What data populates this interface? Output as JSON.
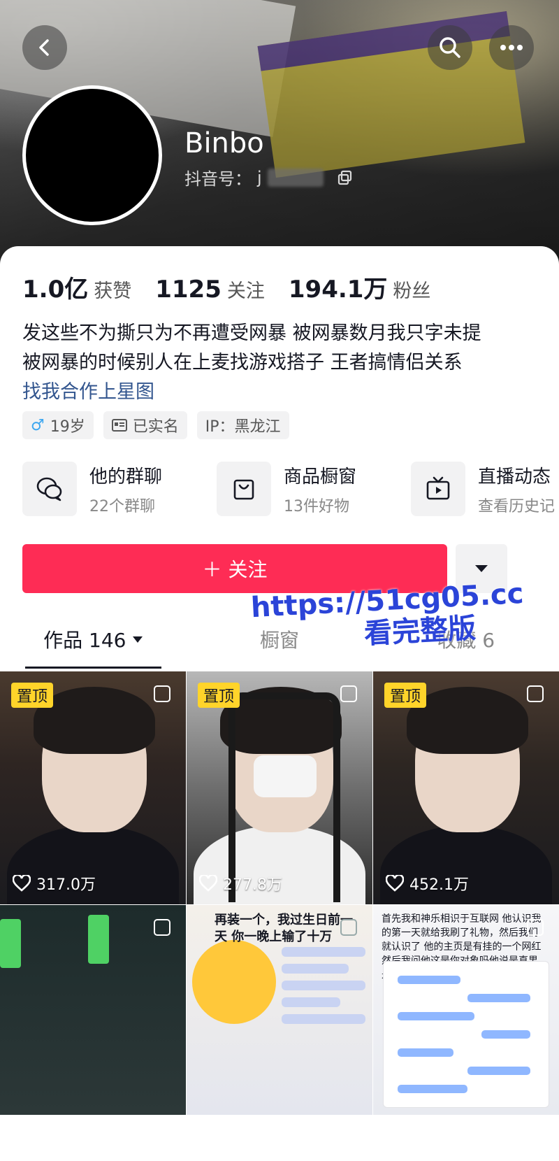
{
  "header": {
    "nickname": "Binbo",
    "account_label": "抖音号：",
    "account_value": "j"
  },
  "stats": [
    {
      "value": "1.0亿",
      "label": "获赞"
    },
    {
      "value": "1125",
      "label": "关注"
    },
    {
      "value": "194.1万",
      "label": "粉丝"
    }
  ],
  "bio": {
    "line1": "发这些不为撕只为不再遭受网暴 被网暴数月我只字未提",
    "line2": "被网暴的时候别人在上麦找游戏搭子 王者搞情侣关系",
    "link": "找我合作上星图"
  },
  "tags": {
    "age": "19岁",
    "gender_symbol": "♂",
    "verified": "已实名",
    "ip": "IP：黑龙江"
  },
  "features": [
    {
      "title": "他的群聊",
      "sub": "22个群聊",
      "icon": "chat-bubbles-icon"
    },
    {
      "title": "商品橱窗",
      "sub": "13件好物",
      "icon": "shopping-bag-icon"
    },
    {
      "title": "直播动态",
      "sub": "查看历史记",
      "icon": "tv-icon"
    }
  ],
  "actions": {
    "follow": "＋ 关注"
  },
  "tabs": {
    "works": "作品 146",
    "second": "橱窗",
    "third": "收藏 6"
  },
  "grid": [
    {
      "pinned": "置顶",
      "likes": "317.0万"
    },
    {
      "pinned": "置顶",
      "likes": "277.8万"
    },
    {
      "pinned": "置顶",
      "likes": "452.1万"
    },
    {
      "caption": ""
    },
    {
      "caption": "再装一个，我过生日前一天 你一晚上输了十万"
    },
    {
      "caption": "首先我和神乐相识于互联网 他认识我的第一天就给我刷了礼物，然后我们就认识了 他的主页是有挂的一个网红 然后我问他这是你对象吗他说是直男是他的朋友"
    }
  ],
  "watermark": {
    "line1": "https://51cg05.cc",
    "line2": "看完整版"
  },
  "colors": {
    "accent": "#fe2c55",
    "link": "#33568f",
    "pin_badge": "#ffd42a"
  }
}
